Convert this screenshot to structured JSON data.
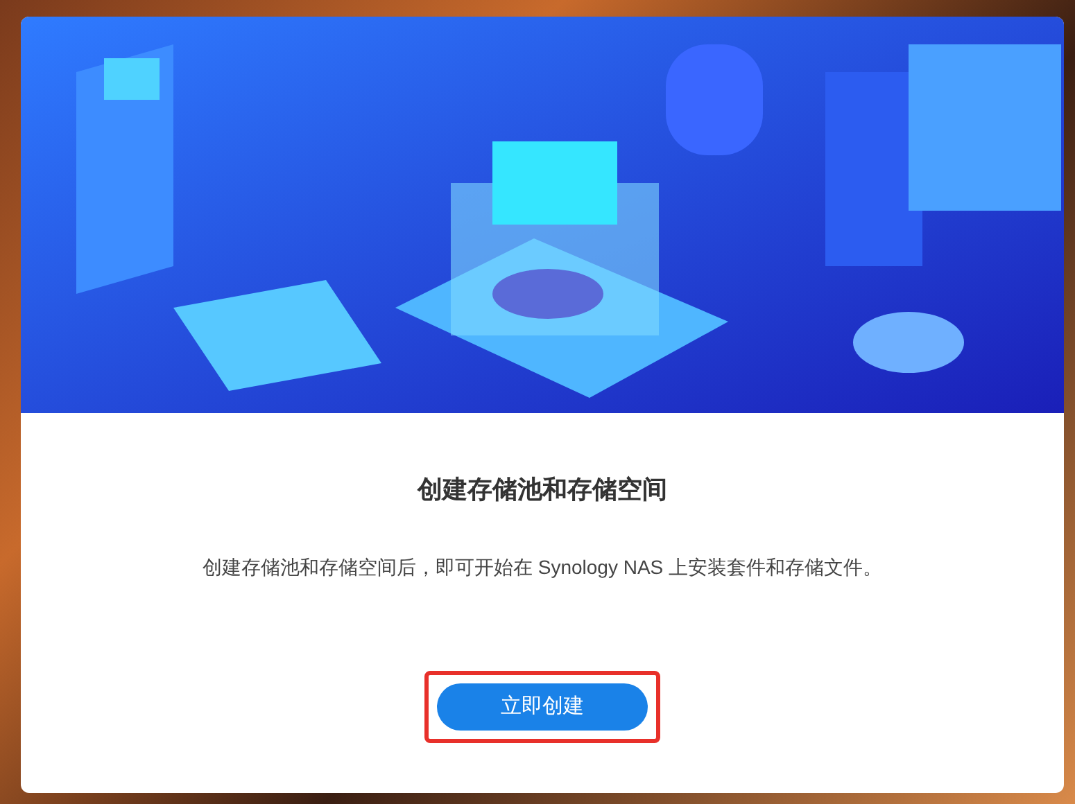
{
  "dialog": {
    "title": "创建存储池和存储空间",
    "description": "创建存储池和存储空间后，即可开始在 Synology NAS 上安装套件和存储文件。",
    "button": {
      "label": "立即创建",
      "highlighted": true
    }
  }
}
